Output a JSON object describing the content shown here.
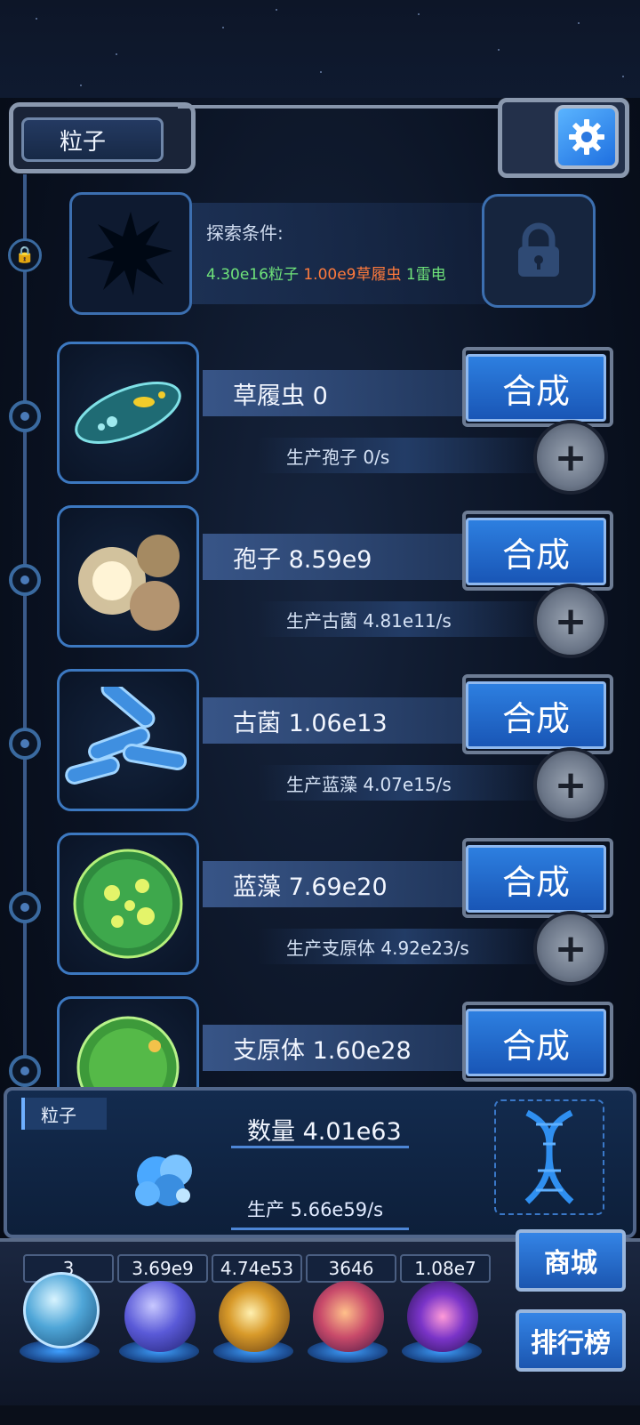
{
  "header": {
    "title": "粒子"
  },
  "explore": {
    "condition_label": "探索条件:",
    "req_particles": "4.30e16粒子",
    "req_paramecium": "1.00e9草履虫",
    "req_thunder": "1雷电"
  },
  "rows": [
    {
      "name": "草履虫 0",
      "production": "生产孢子 0/s",
      "synth_label": "合成"
    },
    {
      "name": "孢子 8.59e9",
      "production": "生产古菌 4.81e11/s",
      "synth_label": "合成"
    },
    {
      "name": "古菌 1.06e13",
      "production": "生产蓝藻 4.07e15/s",
      "synth_label": "合成"
    },
    {
      "name": "蓝藻 7.69e20",
      "production": "生产支原体 4.92e23/s",
      "synth_label": "合成"
    },
    {
      "name": "支原体 1.60e28",
      "production": "",
      "synth_label": "合成"
    }
  ],
  "resource": {
    "tag": "粒子",
    "count": "数量 4.01e63",
    "production": "生产 5.66e59/s"
  },
  "bottom": {
    "values": [
      "3",
      "3.69e9",
      "4.74e53",
      "3646",
      "1.08e7"
    ],
    "shop_label": "商城",
    "rank_label": "排行榜"
  },
  "colors": {
    "accent": "#2d7fe0",
    "green_text": "#6fe37a",
    "orange_text": "#ff7a3c"
  },
  "icons": [
    "gear-icon",
    "lock-icon",
    "plus-icon",
    "dna-icon"
  ]
}
